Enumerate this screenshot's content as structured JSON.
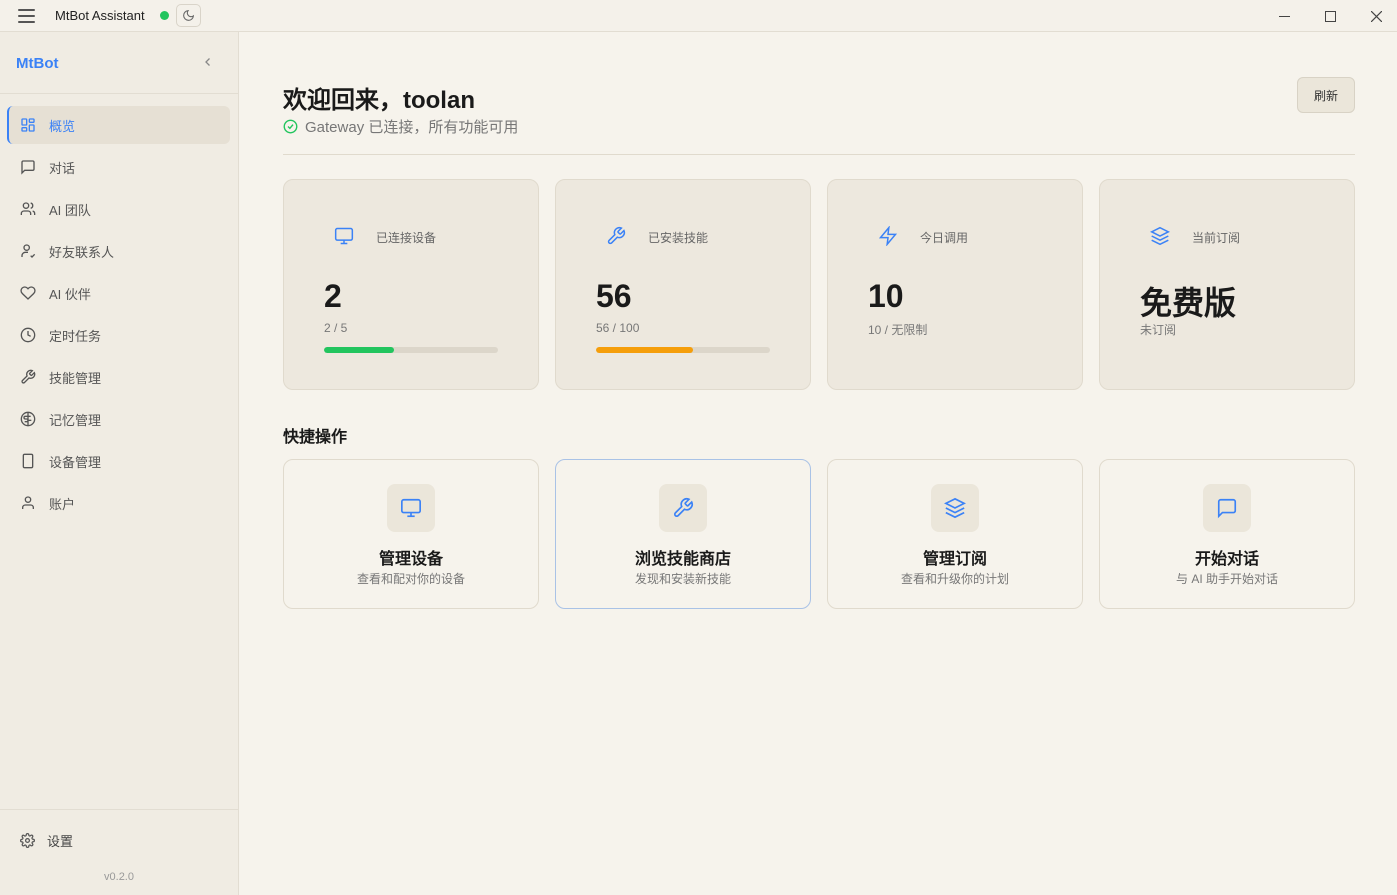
{
  "window": {
    "title": "MtBot Assistant",
    "status_color": "#22c55e"
  },
  "sidebar": {
    "brand": "MtBot",
    "items": [
      {
        "label": "概览",
        "icon": "dashboard-icon",
        "active": true
      },
      {
        "label": "对话",
        "icon": "chat-icon"
      },
      {
        "label": "AI 团队",
        "icon": "team-icon"
      },
      {
        "label": "好友联系人",
        "icon": "contact-icon"
      },
      {
        "label": "AI 伙伴",
        "icon": "heart-icon"
      },
      {
        "label": "定时任务",
        "icon": "clock-icon"
      },
      {
        "label": "技能管理",
        "icon": "wrench-icon"
      },
      {
        "label": "记忆管理",
        "icon": "brain-icon"
      },
      {
        "label": "设备管理",
        "icon": "phone-icon"
      },
      {
        "label": "账户",
        "icon": "user-icon"
      }
    ],
    "settings_label": "设置",
    "version": "v0.2.0"
  },
  "header": {
    "welcome": "欢迎回来，toolan",
    "gateway_status": "Gateway 已连接，所有功能可用",
    "refresh_label": "刷新"
  },
  "stats": [
    {
      "label": "已连接设备",
      "value": "2",
      "sub": "2 / 5",
      "progress": 0.4,
      "color": "#22c55e",
      "icon": "monitor-icon"
    },
    {
      "label": "已安装技能",
      "value": "56",
      "sub": "56 / 100",
      "progress": 0.56,
      "color": "#f59e0b",
      "icon": "wrench-icon"
    },
    {
      "label": "今日调用",
      "value": "10",
      "sub": "10 / 无限制",
      "icon": "lightning-icon"
    },
    {
      "label": "当前订阅",
      "value": "免费版",
      "sub": "未订阅",
      "icon": "layers-icon"
    }
  ],
  "quick_actions": {
    "title": "快捷操作",
    "items": [
      {
        "title": "管理设备",
        "desc": "查看和配对你的设备",
        "icon": "monitor-icon"
      },
      {
        "title": "浏览技能商店",
        "desc": "发现和安装新技能",
        "icon": "wrench-icon"
      },
      {
        "title": "管理订阅",
        "desc": "查看和升级你的计划",
        "icon": "layers-icon"
      },
      {
        "title": "开始对话",
        "desc": "与 AI 助手开始对话",
        "icon": "chat-icon"
      }
    ]
  },
  "accent_color": "#3b82f6"
}
